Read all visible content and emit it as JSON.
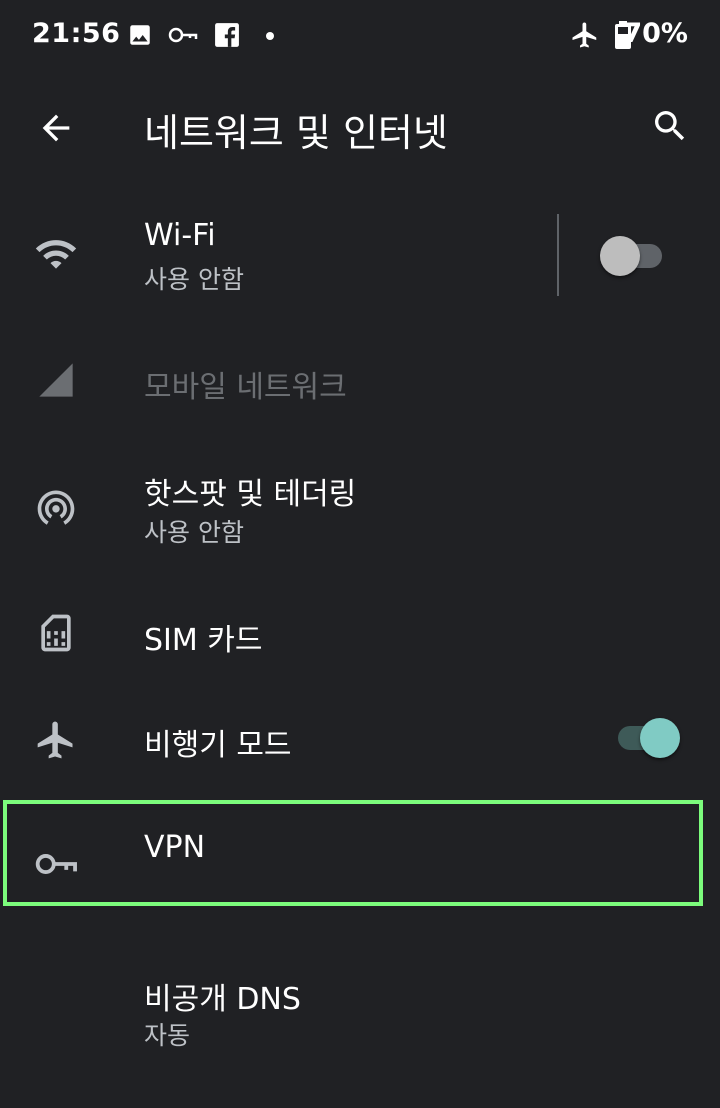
{
  "status_bar": {
    "time": "21:56",
    "left_icons": [
      "image-icon",
      "key-icon",
      "facebook-icon",
      "dot-icon"
    ],
    "right_icons": [
      "airplane-icon",
      "battery-icon"
    ],
    "battery_text": "70%"
  },
  "app_bar": {
    "title": "네트워크 및 인터넷",
    "back_icon": "arrow-back-icon",
    "search_icon": "search-icon"
  },
  "items": [
    {
      "title": "Wi-Fi",
      "subtitle": "사용 안함",
      "icon": "wifi-icon",
      "toggle": false
    },
    {
      "title": "모바일 네트워크",
      "icon": "cell-signal-icon",
      "disabled": true
    },
    {
      "title": "핫스팟 및 테더링",
      "subtitle": "사용 안함",
      "icon": "hotspot-icon"
    },
    {
      "title": "SIM 카드",
      "icon": "sim-card-icon"
    },
    {
      "title": "비행기 모드",
      "icon": "airplane-icon",
      "toggle": true
    },
    {
      "title": "VPN",
      "icon": "vpn-key-icon",
      "highlighted": true
    },
    {
      "title": "비공개 DNS",
      "subtitle": "자동"
    }
  ],
  "colors": {
    "background": "#202124",
    "toggle_on_thumb": "#80cbc4",
    "toggle_on_track": "#3e5a58",
    "toggle_off_thumb": "#bdbdbd",
    "toggle_off_track": "#5f6368",
    "highlight": "#7cfc7c"
  }
}
